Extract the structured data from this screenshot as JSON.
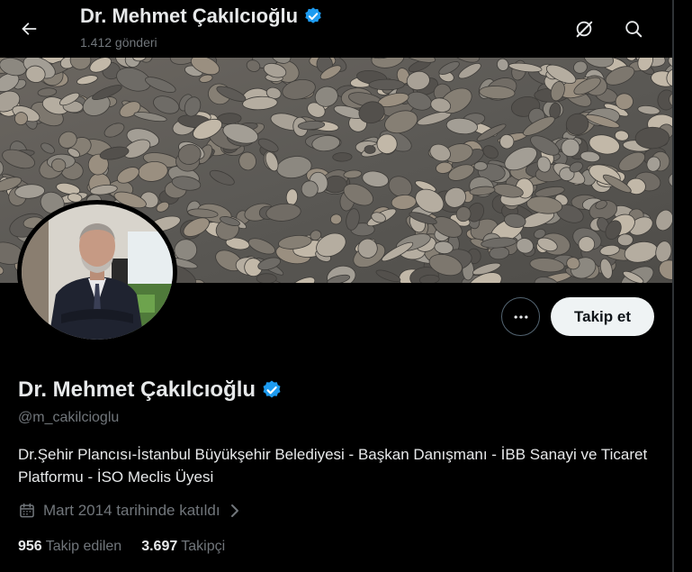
{
  "header": {
    "name": "Dr. Mehmet Çakılcıoğlu",
    "post_count": "1.412 gönderi",
    "back_icon": "arrow-left-icon",
    "grok_icon": "grok-icon",
    "search_icon": "search-icon"
  },
  "profile": {
    "name": "Dr. Mehmet Çakılcıoğlu",
    "handle": "@m_cakilcioglu",
    "bio": "Dr.Şehir Plancısı-İstanbul Büyükşehir Belediyesi - Başkan Danışmanı - İBB Sanayi ve Ticaret Platformu - İSO Meclis Üyesi",
    "joined": "Mart 2014 tarihinde katıldı",
    "following_count": "956",
    "following_label": "Takip edilen",
    "followers_count": "3.697",
    "followers_label": "Takipçi",
    "verified_color": "#1d9bf0"
  },
  "actions": {
    "follow_label": "Takip et",
    "more_icon": "more-icon"
  }
}
